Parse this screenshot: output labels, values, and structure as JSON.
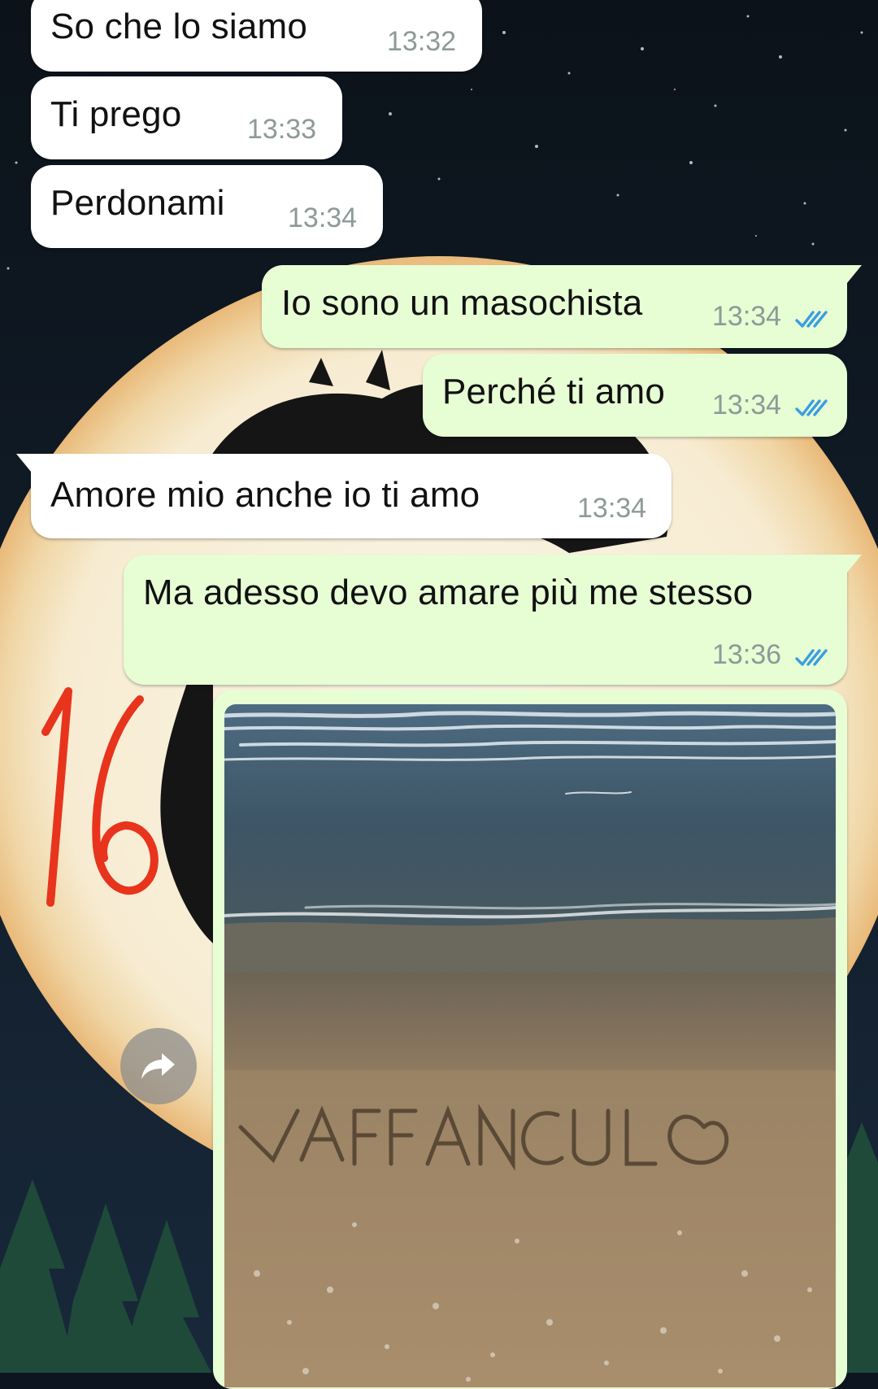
{
  "messages": [
    {
      "text": "So che lo siamo",
      "time": "13:32",
      "direction": "incoming"
    },
    {
      "text": "Ti prego",
      "time": "13:33",
      "direction": "incoming"
    },
    {
      "text": "Perdonami",
      "time": "13:34",
      "direction": "incoming"
    },
    {
      "text": "Io sono un masochista",
      "time": "13:34",
      "direction": "outgoing",
      "status": "read"
    },
    {
      "text": "Perché ti amo",
      "time": "13:34",
      "direction": "outgoing",
      "status": "read"
    },
    {
      "text": "Amore mio anche io ti amo",
      "time": "13:34",
      "direction": "incoming"
    },
    {
      "text": "Ma adesso devo amare più me stesso",
      "time": "13:36",
      "direction": "outgoing",
      "status": "read"
    }
  ],
  "photo_message": {
    "direction": "outgoing",
    "image": "beach-sand-writing-photo",
    "sand_text": "VAFFANCULO"
  },
  "annotation": {
    "text": "16",
    "color": "#e8341c"
  },
  "icons": {
    "read_ticks": "double-check-icon",
    "forward": "forward-arrow-icon"
  },
  "colors": {
    "incoming_bubble": "#ffffff",
    "outgoing_bubble": "#e7fdd4",
    "timestamp": "#8e9a98",
    "read_ticks": "#3b9ee0",
    "wallpaper_sky": "#0d1620",
    "moon": "#f6ead0"
  }
}
